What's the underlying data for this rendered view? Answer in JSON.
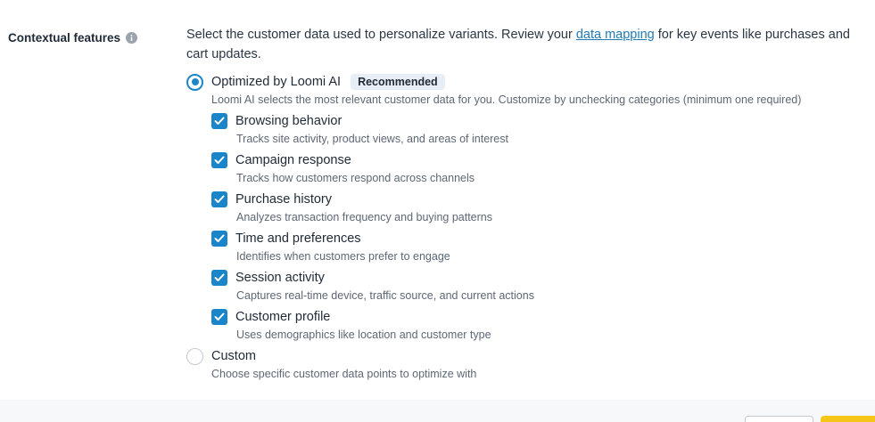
{
  "section": {
    "label": "Contextual features",
    "info_icon": "info-icon"
  },
  "description": {
    "prefix": "Select the customer data used to personalize variants. Review your ",
    "link": "data mapping",
    "suffix": " for key events like purchases and cart updates."
  },
  "options": {
    "optimized": {
      "label": "Optimized by Loomi AI",
      "badge": "Recommended",
      "help": "Loomi AI selects the most relevant customer data for you. Customize by unchecking categories (minimum one required)",
      "checked": true
    },
    "custom": {
      "label": "Custom",
      "help": "Choose specific customer data points to optimize with",
      "checked": false
    }
  },
  "categories": [
    {
      "label": "Browsing behavior",
      "help": "Tracks site activity, product views, and areas of interest",
      "checked": true
    },
    {
      "label": "Campaign response",
      "help": "Tracks how customers respond across channels",
      "checked": true
    },
    {
      "label": "Purchase history",
      "help": "Analyzes transaction frequency and buying patterns",
      "checked": true
    },
    {
      "label": "Time and preferences",
      "help": "Identifies when customers prefer to engage",
      "checked": true
    },
    {
      "label": "Session activity",
      "help": "Captures real-time device, traffic source, and current actions",
      "checked": true
    },
    {
      "label": "Customer profile",
      "help": "Uses demographics like location and customer type",
      "checked": true
    }
  ],
  "colors": {
    "accent": "#1a85c8",
    "link": "#1f7bb6",
    "primary_button": "#f5c518"
  }
}
